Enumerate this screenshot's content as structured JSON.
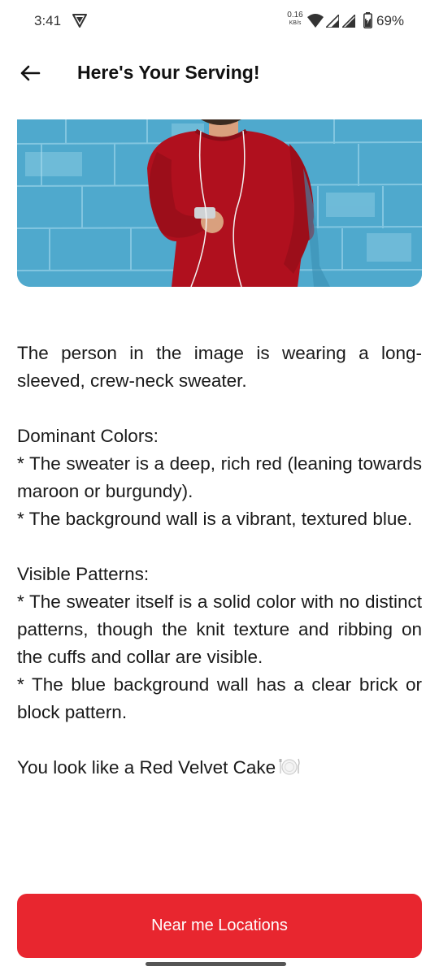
{
  "status_bar": {
    "time": "3:41",
    "net_speed_value": "0.16",
    "net_speed_unit": "KB/s",
    "battery": "69%"
  },
  "header": {
    "title": "Here's Your Serving!"
  },
  "result": {
    "paragraphs": [
      "The person in the image is wearing a long-sleeved, crew-neck sweater.",
      "",
      "Dominant Colors:",
      "* The sweater is a deep, rich red (leaning towards maroon or burgundy).",
      "* The background wall is a vibrant, textured blue.",
      "",
      "Visible Patterns:",
      "* The sweater itself is a solid color with no distinct patterns, though the knit texture and ribbing on the cuffs and collar are visible.",
      "* The blue background wall has a clear brick or block pattern.",
      "",
      "You look like a Red Velvet Cake"
    ]
  },
  "actions": {
    "near_me_label": "Near me Locations"
  },
  "icons": {
    "back": "arrow-left-icon",
    "plate": "plate-icon"
  },
  "colors": {
    "accent": "#e8262f",
    "sweater": "#b0101e",
    "wall": "#4ea8cc"
  }
}
